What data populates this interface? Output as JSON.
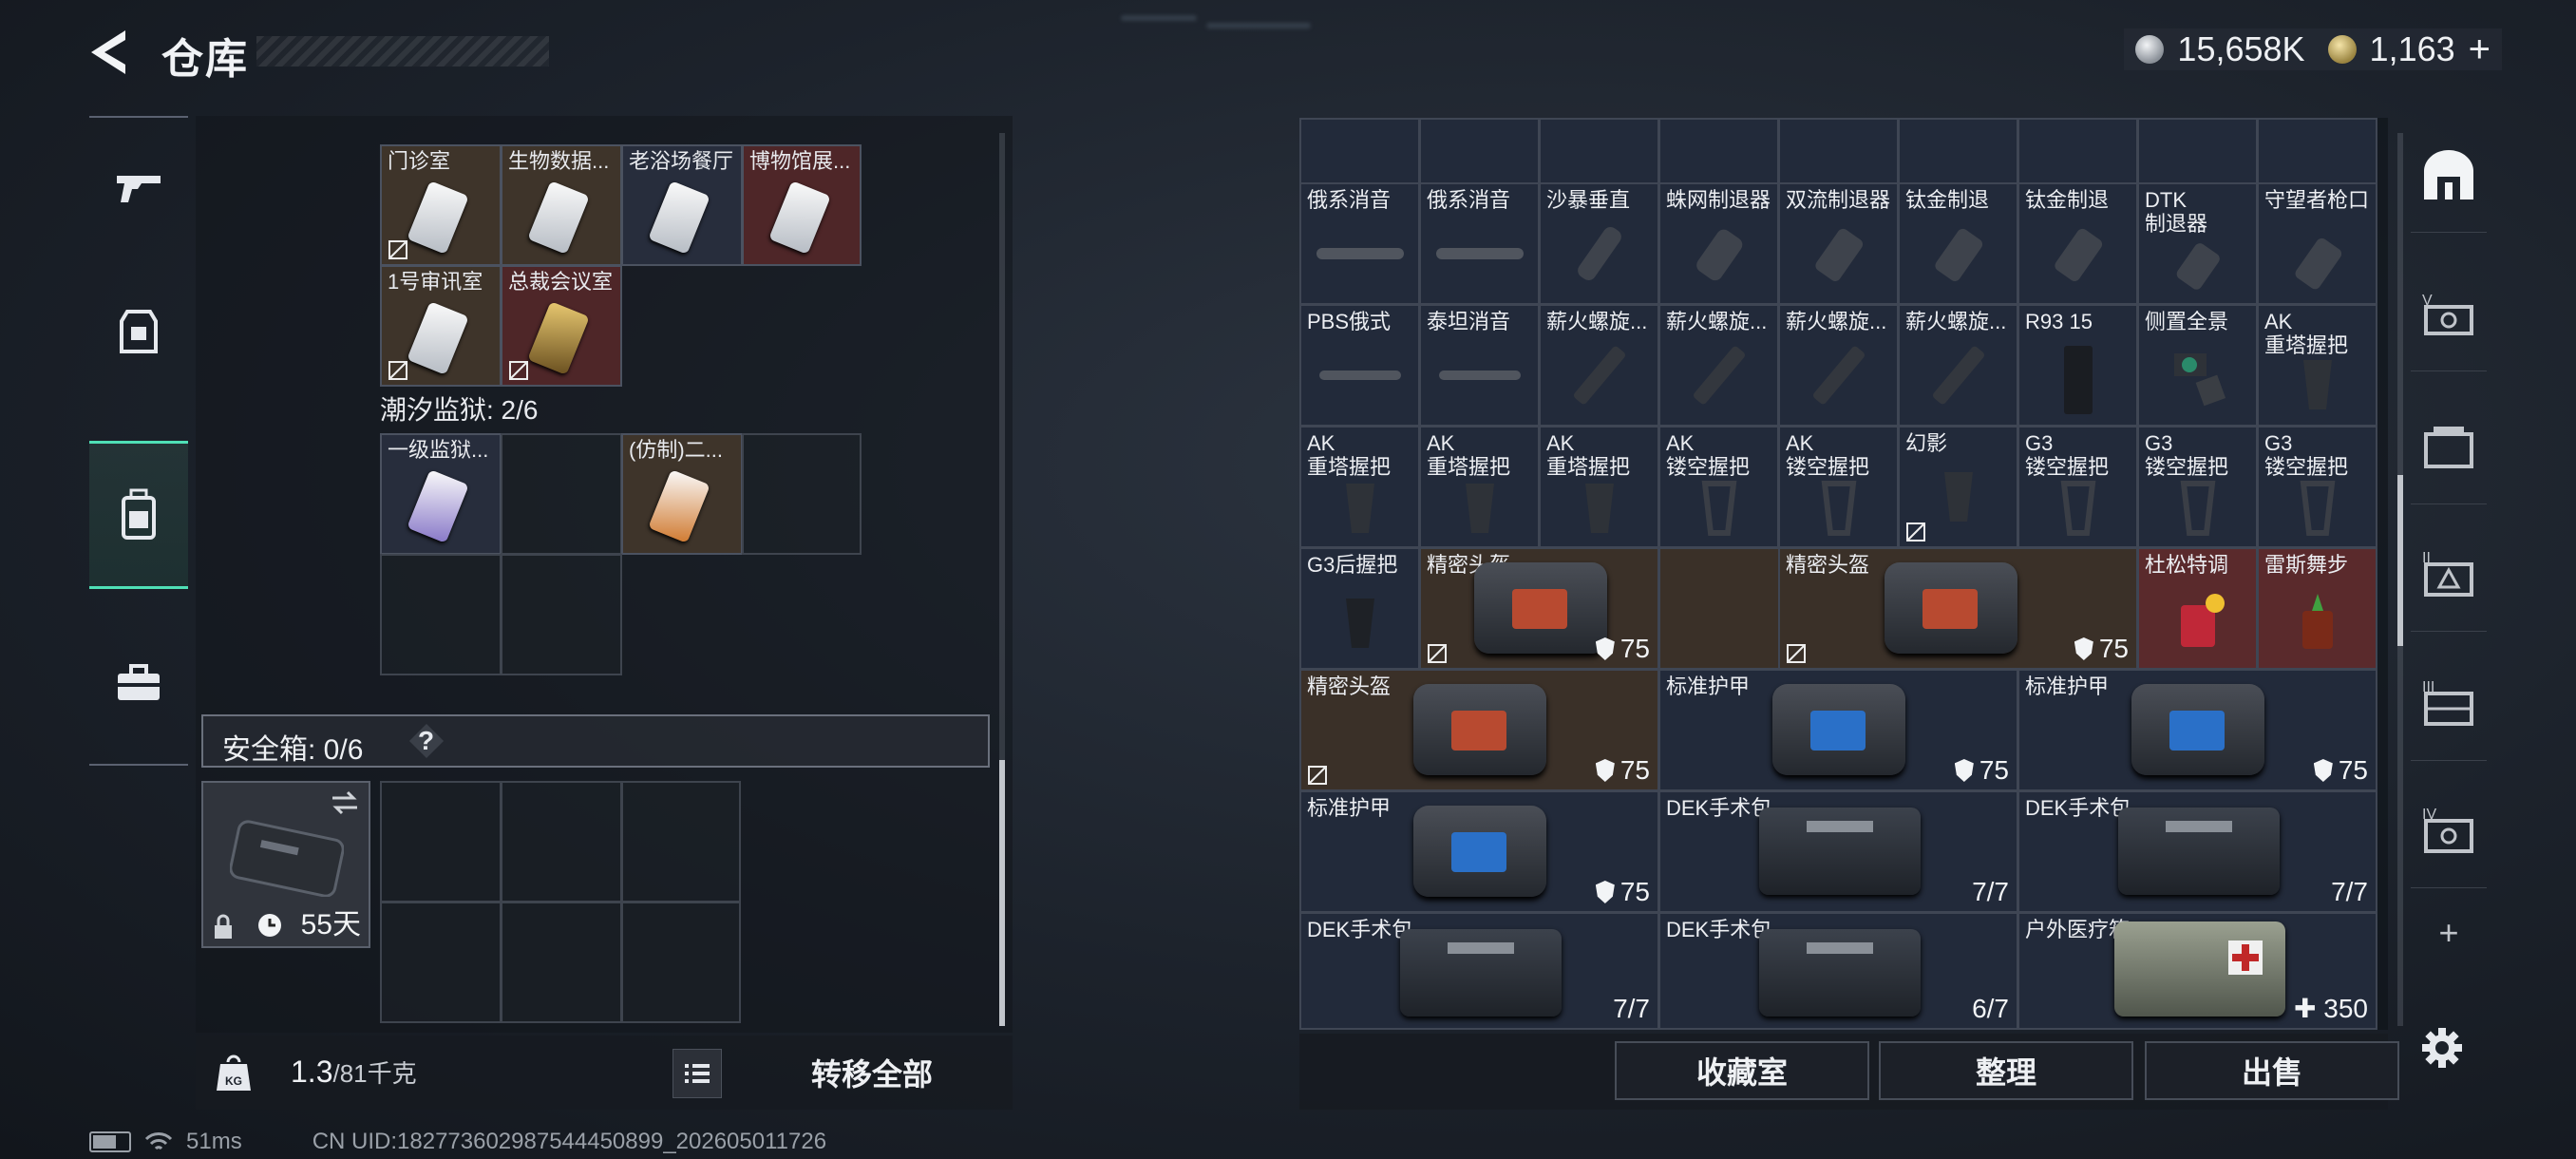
{
  "header": {
    "title": "仓库"
  },
  "currency": {
    "silver": "15,658K",
    "gold": "1,163",
    "plus": "+"
  },
  "left_nav": [
    "weapons",
    "equipment",
    "backpack",
    "toolbox"
  ],
  "left_items": [
    {
      "label": "门诊室",
      "bg": "brown"
    },
    {
      "label": "生物数据...",
      "bg": "brown"
    },
    {
      "label": "老浴场餐厅",
      "bg": "blue"
    },
    {
      "label": "博物馆展...",
      "bg": "red"
    },
    {
      "label": "1号审讯室",
      "bg": "brown"
    },
    {
      "label": "总裁会议室",
      "bg": "red"
    },
    {
      "label": "一级监狱...",
      "bg": "blue"
    },
    {
      "label": "(仿制)二...",
      "bg": "brown"
    }
  ],
  "prison_label": "潮汐监狱: 2/6",
  "safebox": {
    "label": "安全箱: 0/6",
    "help": "?",
    "days": "55天"
  },
  "weight": {
    "current": "1.3",
    "max": "/81千克"
  },
  "transfer_all": "转移全部",
  "grid_items": [
    {
      "label": "俄系消音"
    },
    {
      "label": "俄系消音"
    },
    {
      "label": "沙暴垂直"
    },
    {
      "label": "蛛网制退器"
    },
    {
      "label": "双流制退器"
    },
    {
      "label": "钛金制退"
    },
    {
      "label": "钛金制退"
    },
    {
      "label": "DTK\n制退器"
    },
    {
      "label": "守望者枪口"
    },
    {
      "label": "PBS俄式"
    },
    {
      "label": "泰坦消音"
    },
    {
      "label": "薪火螺旋..."
    },
    {
      "label": "薪火螺旋..."
    },
    {
      "label": "薪火螺旋..."
    },
    {
      "label": "薪火螺旋..."
    },
    {
      "label": "R93 15"
    },
    {
      "label": "侧置全景"
    },
    {
      "label": "AK\n重塔握把"
    },
    {
      "label": "AK\n重塔握把"
    },
    {
      "label": "AK\n重塔握把"
    },
    {
      "label": "AK\n重塔握把"
    },
    {
      "label": "AK\n镂空握把"
    },
    {
      "label": "AK\n镂空握把"
    },
    {
      "label": "幻影"
    },
    {
      "label": "G3\n镂空握把"
    },
    {
      "label": "G3\n镂空握把"
    },
    {
      "label": "G3\n镂空握把"
    },
    {
      "label": "G3后握把"
    },
    {
      "label": "精密头盔",
      "value": "75"
    },
    {
      "label": "精密头盔",
      "value": "75"
    },
    {
      "label": "杜松特调"
    },
    {
      "label": "雷斯舞步"
    },
    {
      "label": "精密头盔",
      "value": "75"
    },
    {
      "label": "标准护甲",
      "value": "75"
    },
    {
      "label": "标准护甲",
      "value": "75"
    },
    {
      "label": "标准护甲",
      "value": "75"
    },
    {
      "label": "DEK手术包",
      "value": "7/7"
    },
    {
      "label": "DEK手术包",
      "value": "7/7"
    },
    {
      "label": "DEK手术包",
      "value": "7/7"
    },
    {
      "label": "DEK手术包",
      "value": "6/7"
    },
    {
      "label": "户外医疗箱",
      "value": "350"
    }
  ],
  "right_buttons": {
    "collection": "收藏室",
    "sort": "整理",
    "sell": "出售"
  },
  "right_nav": [
    "lobby",
    "stash-v",
    "stash-box",
    "stash-triangle",
    "stash-iii",
    "stash-iv",
    "add",
    "settings"
  ],
  "status": {
    "ping": "51ms",
    "uid": "CN UID:182773602987544450899_202605011726"
  }
}
